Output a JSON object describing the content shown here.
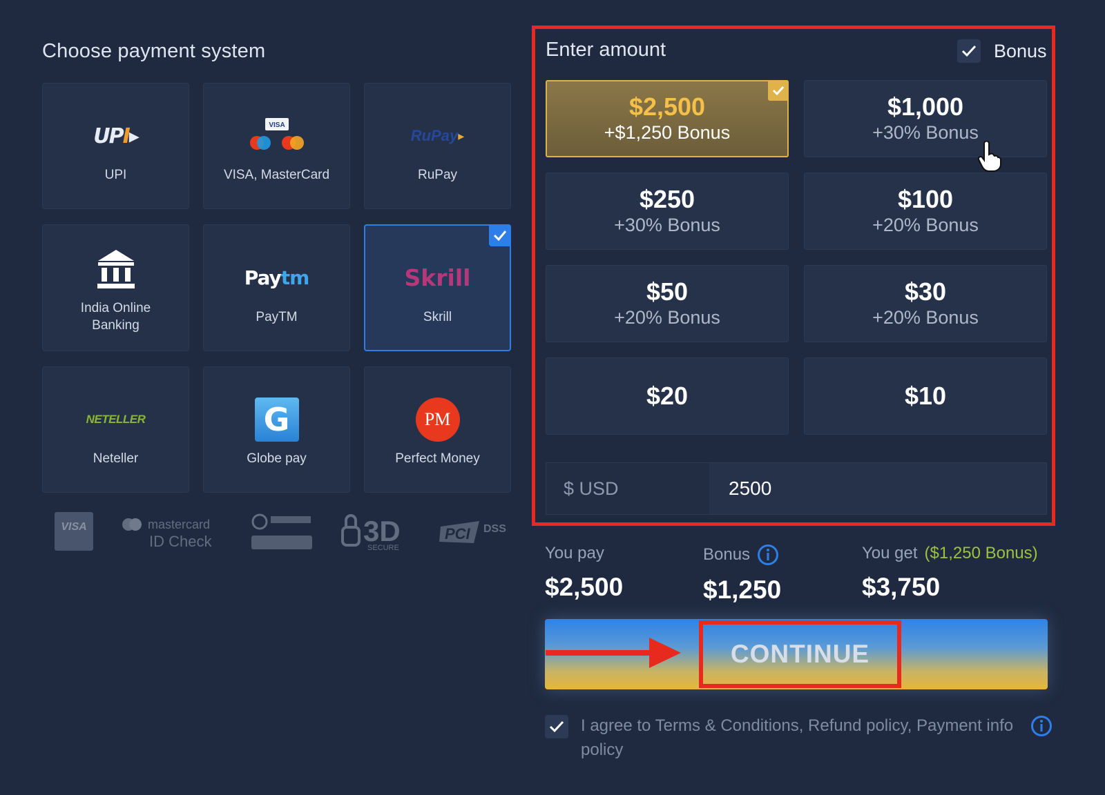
{
  "left": {
    "title": "Choose payment system",
    "methods": [
      {
        "label": "UPI",
        "logo_text": "UPI"
      },
      {
        "label": "VISA, MasterCard"
      },
      {
        "label": "RuPay",
        "logo_text": "RuPay"
      },
      {
        "label": "India Online\nBanking"
      },
      {
        "label": "PayTM"
      },
      {
        "label": "Skrill",
        "logo_text": "Skrill",
        "selected": true
      },
      {
        "label": "Neteller",
        "logo_text": "NETELLER"
      },
      {
        "label": "Globe pay",
        "logo_text": "G"
      },
      {
        "label": "Perfect Money",
        "logo_text": "PM"
      }
    ],
    "security_badges": [
      "VISA",
      "mastercard",
      "ID Check",
      "3D",
      "SECURE",
      "PCI",
      "DSS"
    ]
  },
  "right": {
    "title": "Enter amount",
    "bonus_label": "Bonus",
    "bonus_checked": true,
    "amounts": [
      {
        "amount": "$2,500",
        "bonus": "+$1,250 Bonus",
        "selected": true
      },
      {
        "amount": "$1,000",
        "bonus": "+30% Bonus"
      },
      {
        "amount": "$250",
        "bonus": "+30% Bonus"
      },
      {
        "amount": "$100",
        "bonus": "+20% Bonus"
      },
      {
        "amount": "$50",
        "bonus": "+20% Bonus"
      },
      {
        "amount": "$30",
        "bonus": "+20% Bonus"
      },
      {
        "amount": "$20",
        "bonus": ""
      },
      {
        "amount": "$10",
        "bonus": ""
      }
    ],
    "currency": "$ USD",
    "amount_value": "2500",
    "summary": {
      "you_pay_label": "You pay",
      "you_pay_value": "$2,500",
      "bonus_label": "Bonus",
      "bonus_value": "$1,250",
      "you_get_label": "You get",
      "you_get_bonus": "($1,250 Bonus)",
      "you_get_value": "$3,750"
    },
    "continue_label": "CONTINUE",
    "agree_text": "I agree to Terms & Conditions, Refund policy, Payment info policy",
    "agree_checked": true
  },
  "colors": {
    "background": "#1f2a40",
    "highlight_red": "#e8291e",
    "selected_blue": "#2d7ee8",
    "selected_gold": "#e0b24a",
    "bonus_green": "#9dc23e"
  },
  "icons": [
    "check-icon",
    "bank-icon",
    "info-icon",
    "hand-cursor-icon",
    "arrow-right-icon"
  ]
}
